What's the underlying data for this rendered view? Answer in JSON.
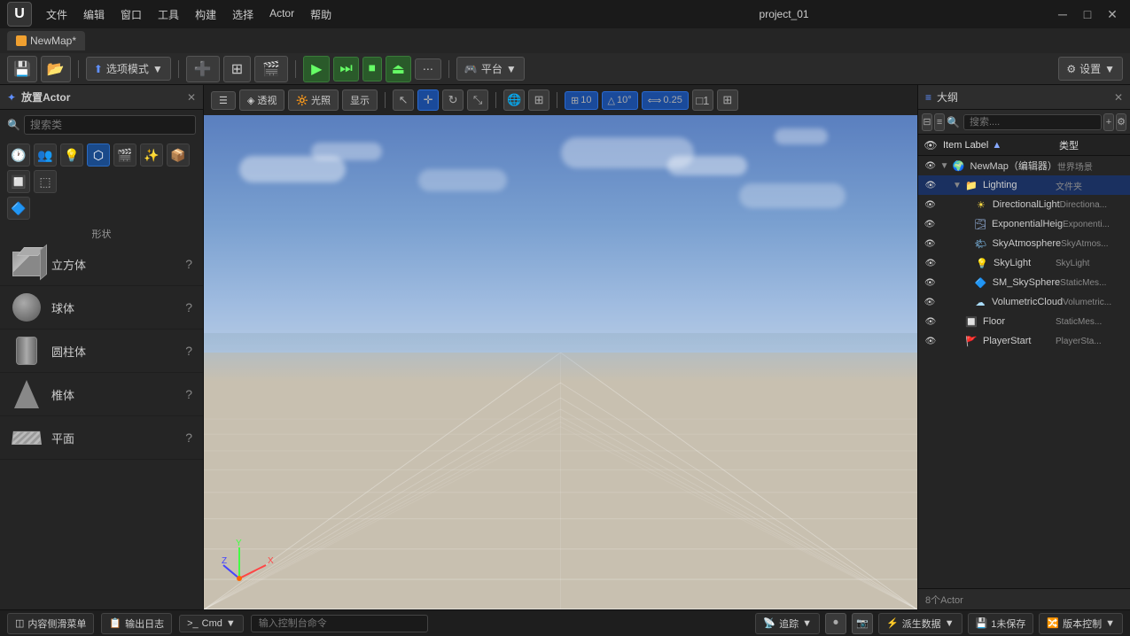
{
  "titlebar": {
    "menus": [
      "文件",
      "编辑",
      "窗口",
      "工具",
      "构建",
      "选择",
      "Actor",
      "帮助"
    ],
    "project_name": "project_01",
    "window_controls": [
      "─",
      "□",
      "✕"
    ]
  },
  "tabbar": {
    "tab_label": "NewMap*"
  },
  "toolbar": {
    "place_mode": "选项模式",
    "add_btn": "+",
    "platform_label": "平台",
    "settings_label": "设置"
  },
  "viewport": {
    "view_mode": "透视",
    "lighting": "光照",
    "show": "显示",
    "grid_size": "10",
    "angle": "10°",
    "scale": "0.25",
    "layer": "1"
  },
  "left_panel": {
    "title": "放置Actor",
    "search_placeholder": "搜索类",
    "shapes_label": "形状",
    "shapes": [
      {
        "name": "立方体",
        "type": "cube"
      },
      {
        "name": "球体",
        "type": "sphere"
      },
      {
        "name": "圆柱体",
        "type": "cylinder"
      },
      {
        "name": "椎体",
        "type": "cone"
      },
      {
        "name": "平面",
        "type": "plane"
      }
    ]
  },
  "outliner": {
    "title": "大纲",
    "search_placeholder": "搜索....",
    "col_item_label": "Item Label",
    "col_type_label": "类型",
    "footer": "8个Actor",
    "items": [
      {
        "indent": 0,
        "expand": "▼",
        "icon": "🌍",
        "name": "NewMap（编辑器）",
        "type": "世界场景",
        "level": 0
      },
      {
        "indent": 1,
        "expand": "▼",
        "icon": "📁",
        "name": "Lighting",
        "type": "文件夹",
        "level": 1,
        "folder": true
      },
      {
        "indent": 2,
        "expand": " ",
        "icon": "☀",
        "name": "DirectionalLight",
        "type": "Directional",
        "level": 2
      },
      {
        "indent": 2,
        "expand": " ",
        "icon": "🌫",
        "name": "ExponentialHeig",
        "type": "Exponenti",
        "level": 2
      },
      {
        "indent": 2,
        "expand": " ",
        "icon": "🌤",
        "name": "SkyAtmosphere",
        "type": "SkyAtmos",
        "level": 2
      },
      {
        "indent": 2,
        "expand": " ",
        "icon": "💡",
        "name": "SkyLight",
        "type": "SkyLight",
        "level": 2
      },
      {
        "indent": 2,
        "expand": " ",
        "icon": "🔷",
        "name": "SM_SkySphere",
        "type": "StaticMes",
        "level": 2
      },
      {
        "indent": 2,
        "expand": " ",
        "icon": "☁",
        "name": "VolumetricCloud",
        "type": "Volumetric",
        "level": 2
      },
      {
        "indent": 1,
        "expand": " ",
        "icon": "🔲",
        "name": "Floor",
        "type": "StaticMes",
        "level": 1
      },
      {
        "indent": 1,
        "expand": " ",
        "icon": "🚩",
        "name": "PlayerStart",
        "type": "PlayerSta",
        "level": 1
      }
    ]
  },
  "statusbar": {
    "content_browser": "内容侧滑菜单",
    "output_log": "输出日志",
    "cmd_label": "Cmd",
    "input_placeholder": "输入控制台命令",
    "trace": "追踪",
    "spawn_data": "派生数据",
    "unsaved": "1未保存",
    "version_control": "版本控制"
  }
}
